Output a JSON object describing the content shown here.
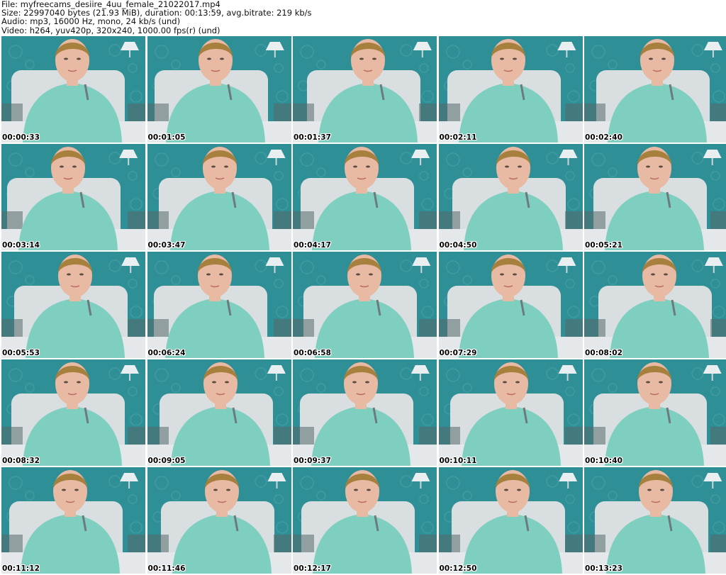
{
  "header": {
    "file_line": "File: myfreecams_desiire_4uu_female_21022017.mp4",
    "size_line": "Size: 22997040 bytes (21.93 MiB), duration: 00:13:59, avg.bitrate: 219 kb/s",
    "audio_line": "Audio: mp3, 16000 Hz, mono, 24 kb/s (und)",
    "video_line": "Video: h264, yuv420p, 320x240, 1000.00 fps(r) (und)"
  },
  "thumbnails": [
    {
      "timestamp": "00:00:33"
    },
    {
      "timestamp": "00:01:05"
    },
    {
      "timestamp": "00:01:37"
    },
    {
      "timestamp": "00:02:11"
    },
    {
      "timestamp": "00:02:40"
    },
    {
      "timestamp": "00:03:14"
    },
    {
      "timestamp": "00:03:47"
    },
    {
      "timestamp": "00:04:17"
    },
    {
      "timestamp": "00:04:50"
    },
    {
      "timestamp": "00:05:21"
    },
    {
      "timestamp": "00:05:53"
    },
    {
      "timestamp": "00:06:24"
    },
    {
      "timestamp": "00:06:58"
    },
    {
      "timestamp": "00:07:29"
    },
    {
      "timestamp": "00:08:02"
    },
    {
      "timestamp": "00:08:32"
    },
    {
      "timestamp": "00:09:05"
    },
    {
      "timestamp": "00:09:37"
    },
    {
      "timestamp": "00:10:11"
    },
    {
      "timestamp": "00:10:40"
    },
    {
      "timestamp": "00:11:12"
    },
    {
      "timestamp": "00:11:46"
    },
    {
      "timestamp": "00:12:17"
    },
    {
      "timestamp": "00:12:50"
    },
    {
      "timestamp": "00:13:23"
    }
  ],
  "colors": {
    "wall": "#2f8f96",
    "wall_pattern": "#5fb3b8",
    "headboard": "#d9dfe0",
    "sweater": "#7fcfc0",
    "skin": "#e8b9a3",
    "hair": "#a8803e"
  }
}
